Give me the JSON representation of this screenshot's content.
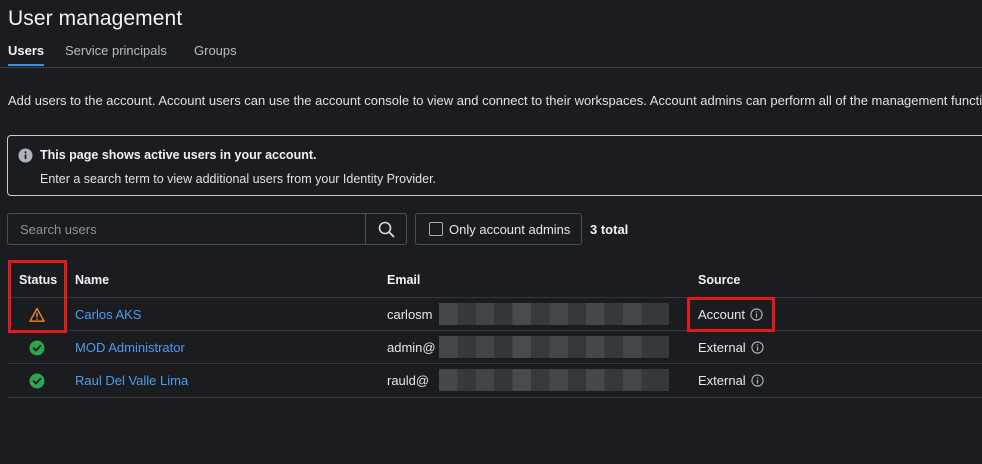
{
  "page": {
    "title": "User management",
    "tabs": [
      {
        "label": "Users",
        "active": true
      },
      {
        "label": "Service principals",
        "active": false
      },
      {
        "label": "Groups",
        "active": false
      }
    ],
    "description": "Add users to the account. Account users can use the account console to view and connect to their workspaces. Account admins can perform all of the management functio"
  },
  "banner": {
    "icon": "info-icon",
    "title": "This page shows active users in your account.",
    "body": "Enter a search term to view additional users from your Identity Provider."
  },
  "toolbar": {
    "search_placeholder": "Search users",
    "search_icon": "search-icon",
    "filter_label": "Only account admins",
    "filter_checked": false,
    "total": "3 total"
  },
  "table": {
    "headers": {
      "status": "Status",
      "name": "Name",
      "email": "Email",
      "source": "Source"
    },
    "rows": [
      {
        "status": "warning",
        "name": "Carlos AKS",
        "email": "carlosm",
        "source": "Account"
      },
      {
        "status": "active",
        "name": "MOD Administrator",
        "email": "admin@",
        "source": "External"
      },
      {
        "status": "active",
        "name": "Raul Del Valle Lima",
        "email": "rauld@",
        "source": "External"
      }
    ]
  },
  "colors": {
    "accent": "#3d8fe0",
    "link": "#4b9cf0",
    "warning": "#f0872f",
    "success": "#2ea44f",
    "highlight": "#e01b1b"
  }
}
